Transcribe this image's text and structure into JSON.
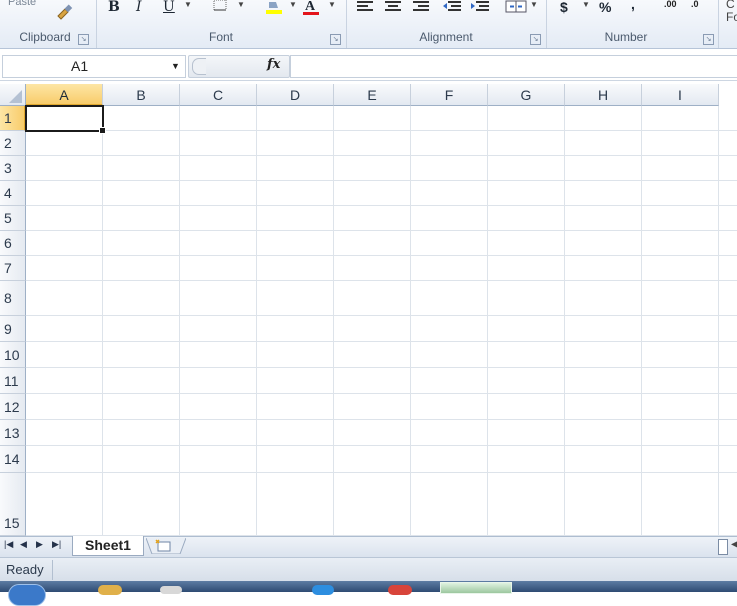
{
  "ribbon": {
    "paste_label": "Paste",
    "groups": [
      {
        "name": "clipboard",
        "label": "Clipboard"
      },
      {
        "name": "font",
        "label": "Font"
      },
      {
        "name": "alignment",
        "label": "Alignment"
      },
      {
        "name": "number",
        "label": "Number"
      }
    ],
    "font_buttons": {
      "bold": "B",
      "italic": "I",
      "underline": "U",
      "font_color": "A"
    },
    "number_buttons": {
      "currency": "$",
      "percent": "%",
      "comma": ",",
      "inc_decimal": ".00",
      "dec_decimal": ".0"
    },
    "cut_off_group_text": "C\nFo",
    "font_color_accent": "#e3141b",
    "highlight_accent": "#ffff00"
  },
  "formula_bar": {
    "name_box_value": "A1",
    "fx_label": "fx",
    "formula_value": ""
  },
  "grid": {
    "columns": [
      "A",
      "B",
      "C",
      "D",
      "E",
      "F",
      "G",
      "H",
      "I"
    ],
    "rows": [
      "1",
      "2",
      "3",
      "4",
      "5",
      "6",
      "7",
      "8",
      "9",
      "10",
      "11",
      "12",
      "13",
      "14",
      "15"
    ],
    "selected_cell": "A1",
    "selection_accent": "#f8cc6b"
  },
  "sheets": {
    "tabs": [
      "Sheet1"
    ],
    "active": "Sheet1"
  },
  "status_bar": {
    "status_text": "Ready"
  }
}
